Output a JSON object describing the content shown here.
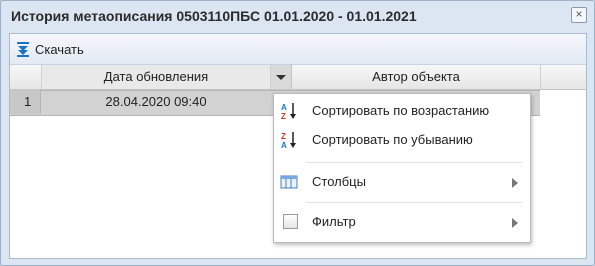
{
  "window": {
    "title": "История метаописания 0503110ПБС 01.01.2020 - 01.01.2021",
    "close_glyph": "×"
  },
  "toolbar": {
    "download_label": "Скачать"
  },
  "grid": {
    "columns": [
      {
        "label": "Дата обновления"
      },
      {
        "label": "Автор объекта"
      }
    ],
    "rows": [
      {
        "num": "1",
        "date": "28.04.2020 09:40",
        "author": ""
      }
    ]
  },
  "menu": {
    "items": [
      {
        "label": "Сортировать по возрастанию",
        "icon": "sort-ascending-icon"
      },
      {
        "label": "Сортировать по убыванию",
        "icon": "sort-descending-icon"
      },
      {
        "label": "Столбцы",
        "icon": "columns-icon",
        "submenu": true
      },
      {
        "label": "Фильтр",
        "icon": "filter-checkbox",
        "submenu": true
      }
    ]
  },
  "colors": {
    "accent": "#1a73c9",
    "window_bg": "#dce6f3"
  }
}
